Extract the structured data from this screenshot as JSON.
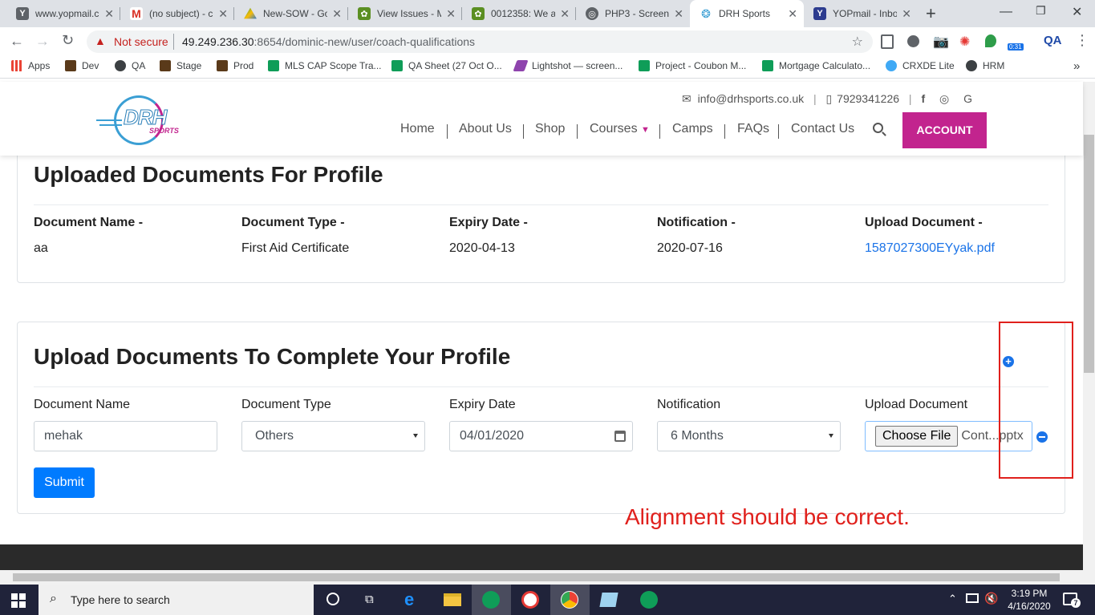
{
  "browser": {
    "tabs": [
      {
        "title": "www.yopmail.c",
        "icon": "yopmail-icon",
        "color": "#5f6368"
      },
      {
        "title": "(no subject) - c",
        "icon": "gmail-icon",
        "color": "#d93025"
      },
      {
        "title": "New-SOW - Go",
        "icon": "drive-icon",
        "color": "#1a73e8"
      },
      {
        "title": "View Issues - M",
        "icon": "mantis-icon",
        "color": "#5b8f22"
      },
      {
        "title": "0012358: We a",
        "icon": "mantis-icon",
        "color": "#5b8f22"
      },
      {
        "title": "PHP3 - Screen",
        "icon": "php-icon",
        "color": "#5f6368"
      },
      {
        "title": "DRH Sports",
        "icon": "drh-icon",
        "color": "#3b9fd4"
      },
      {
        "title": "YOPmail - Inbo",
        "icon": "yopmail-icon",
        "color": "#2d3c8f"
      }
    ],
    "new_tab": "+",
    "security": "Not secure",
    "url_host": "49.249.236.30",
    "url_rest": ":8654/dominic-new/user/coach-qualifications",
    "ext_badge": "0:31",
    "bookmarks": [
      {
        "label": "Apps",
        "color": "#1a73e8"
      },
      {
        "label": "Dev",
        "color": "#5a3a1a"
      },
      {
        "label": "QA",
        "color": "#3c4043"
      },
      {
        "label": "Stage",
        "color": "#5a3a1a"
      },
      {
        "label": "Prod",
        "color": "#5a3a1a"
      },
      {
        "label": "MLS CAP Scope Tra...",
        "color": "#0f9d58"
      },
      {
        "label": "QA Sheet (27 Oct O...",
        "color": "#0f9d58"
      },
      {
        "label": "Lightshot — screen...",
        "color": "#8e44ad"
      },
      {
        "label": "Project - Coubon M...",
        "color": "#0f9d58"
      },
      {
        "label": "Mortgage Calculato...",
        "color": "#0f9d58"
      },
      {
        "label": "CRXDE Lite",
        "color": "#3fa9f5"
      },
      {
        "label": "HRM",
        "color": "#3c4043"
      }
    ],
    "bookmarks_more": "»"
  },
  "site": {
    "logo_top": "DRH",
    "logo_bottom": "SPORTS",
    "email": "info@drhsports.co.uk",
    "phone": "7929341226",
    "nav": [
      "Home",
      "About Us",
      "Shop",
      "Courses",
      "Camps",
      "FAQs",
      "Contact Us"
    ],
    "account": "ACCOUNT",
    "brand_color": "#c2248e"
  },
  "uploaded": {
    "title": "Uploaded Documents For Profile",
    "headers": [
      "Document Name -",
      "Document Type -",
      "Expiry Date -",
      "Notification -",
      "Upload Document -"
    ],
    "row": [
      "aa",
      "First Aid Certificate",
      "2020-04-13",
      "2020-07-16",
      "1587027300EYyak.pdf"
    ]
  },
  "upload_form": {
    "title": "Upload Documents To Complete Your Profile",
    "labels": [
      "Document Name",
      "Document Type",
      "Expiry Date",
      "Notification",
      "Upload Document"
    ],
    "document_name": "mehak",
    "document_type": "Others",
    "expiry_date": "04/01/2020",
    "notification": "6 Months",
    "choose_file": "Choose File",
    "file_name": "Cont...pptx",
    "submit": "Submit"
  },
  "annotation": {
    "text": "Alignment should be correct.",
    "color": "#e0201c"
  },
  "taskbar": {
    "search": "Type here to search",
    "time": "3:19 PM",
    "date": "4/16/2020",
    "notif_count": "7"
  }
}
